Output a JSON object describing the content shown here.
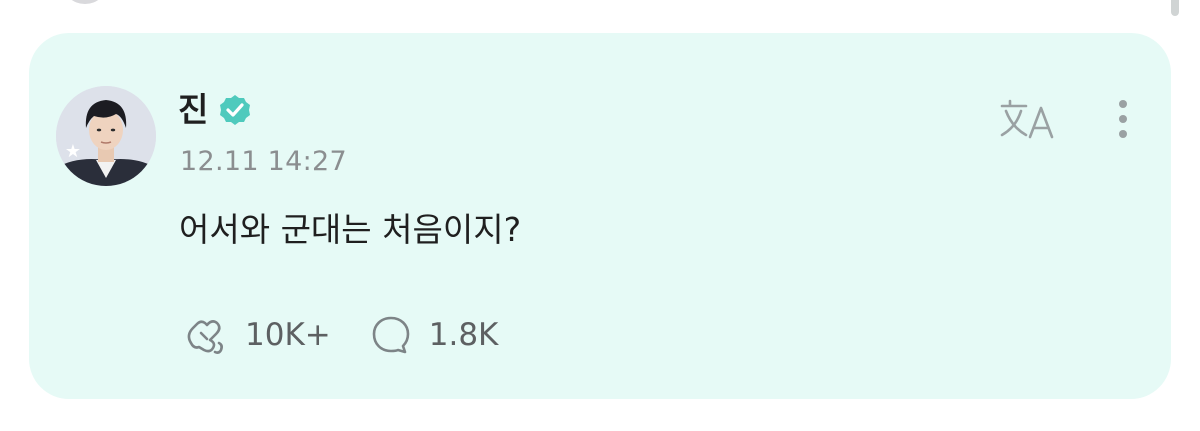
{
  "post": {
    "author": {
      "name": "진",
      "verified": true,
      "avatar": "avatar"
    },
    "timestamp": "12.11 14:27",
    "text": "어서와 군대는 처음이지?",
    "actions": {
      "like_icon": "like-icon",
      "like_count": "10K+",
      "comment_icon": "comment-icon",
      "comment_count": "1.8K"
    },
    "top_right": {
      "translate_icon": "translate-icon",
      "more_icon": "more-options-icon"
    }
  },
  "colors": {
    "card_background": "#e6faf6",
    "accent": "#4fcabd",
    "text_primary": "#1f1f1f",
    "text_secondary": "#8b8e90",
    "icon_gray": "#9aa1a3"
  }
}
